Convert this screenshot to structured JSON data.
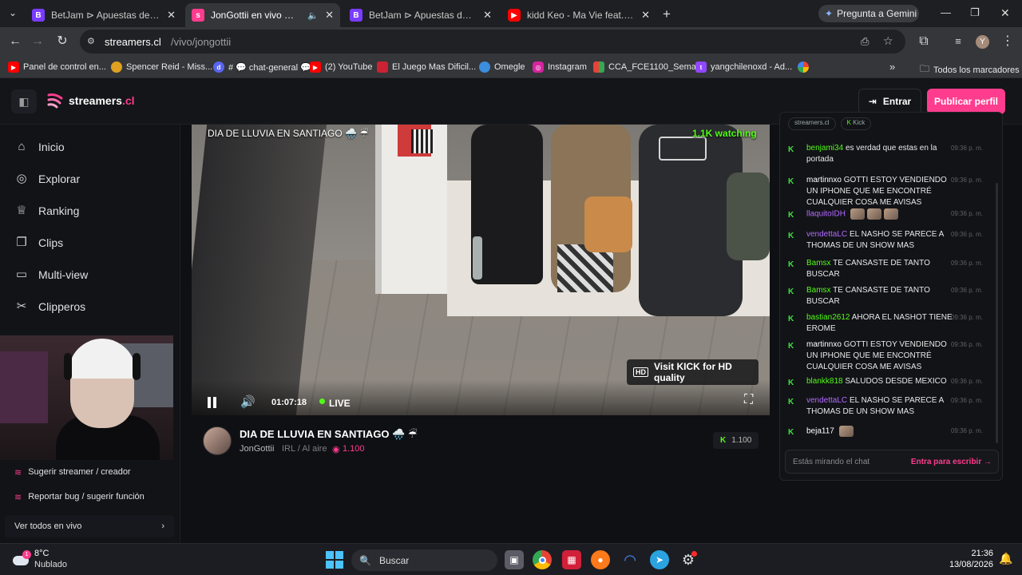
{
  "browser": {
    "tabs": [
      {
        "title": "BetJam ⊳ Apuestas deportivas",
        "favicon": "betjam-icon",
        "color": "#7a3cff"
      },
      {
        "title": "JonGottii en vivo — streamers",
        "favicon": "streamers-icon",
        "color": "#ff3c8e"
      },
      {
        "title": "BetJam ⊳ Apuestas deportivas",
        "favicon": "betjam-icon",
        "color": "#7a3cff"
      },
      {
        "title": "kidd Keo - Ma Vie feat. Yay (Bie",
        "favicon": "youtube-icon",
        "color": "#ff0000"
      }
    ],
    "gemini_label": "Pregunta a Gemini",
    "url_host": "streamers.cl",
    "url_path": "/vivo/jongottii",
    "profile_initial": "Y",
    "bookmarks": [
      {
        "label": "Panel de control en...",
        "icon": "youtube-icon",
        "color": "#ff0000"
      },
      {
        "label": "Spencer Reid - Miss...",
        "icon": "site-icon",
        "color": "#e0a020"
      },
      {
        "label": "# 💬 chat-general 💬",
        "icon": "discord-icon",
        "color": "#5865f2"
      },
      {
        "label": "(2) YouTube",
        "icon": "youtube-icon",
        "color": "#ff0000"
      },
      {
        "label": "El Juego Mas Dificil...",
        "icon": "site-icon",
        "color": "#cc2233"
      },
      {
        "label": "Omegle",
        "icon": "omegle-icon",
        "color": "#3b8dde"
      },
      {
        "label": "Instagram",
        "icon": "instagram-icon",
        "color": "#d6249f"
      },
      {
        "label": "CCA_FCE1100_Sema...",
        "icon": "grid-icon",
        "color": "#e94335"
      },
      {
        "label": "yangchilenoxd - Ad...",
        "icon": "twitch-icon",
        "color": "#9146ff"
      }
    ],
    "all_bookmarks_label": "Todos los marcadores"
  },
  "site": {
    "logo_text": "streamers",
    "logo_suffix": ".cl",
    "login_label": "Entrar",
    "publish_label": "Publicar perfil",
    "accent": "#ff3c8e"
  },
  "sidebar": {
    "items": [
      {
        "label": "Inicio",
        "icon": "home-icon"
      },
      {
        "label": "Explorar",
        "icon": "compass-icon"
      },
      {
        "label": "Ranking",
        "icon": "trophy-icon"
      },
      {
        "label": "Clips",
        "icon": "clips-icon"
      },
      {
        "label": "Multi-view",
        "icon": "multiview-icon"
      },
      {
        "label": "Clipperos",
        "icon": "scissors-icon"
      }
    ],
    "suggest_label": "Sugerir streamer / creador",
    "report_label": "Reportar bug / sugerir función",
    "all_live_label": "Ver todos en vivo"
  },
  "player": {
    "overlay_title": "DIA DE LLUVIA EN SANTIAGO 🌧️ ☔",
    "watching": "1.1K watching",
    "hd_badge": "HD",
    "hd_text": "Visit KICK for HD quality",
    "time": "01:07:18",
    "live_label": "LIVE"
  },
  "stream": {
    "title": "DIA DE LLUVIA EN SANTIAGO 🌧️ ☔",
    "channel": "JonGottii",
    "category": "IRL / Al aire",
    "viewers": "1.100",
    "platform_viewers": "1.100"
  },
  "chat": {
    "tags": [
      "streamers.cl",
      "Kick"
    ],
    "messages": [
      {
        "user": "benjami34",
        "color": "#53fc18",
        "text": "es verdad que estas en la portada",
        "time": "09:36 p. m."
      },
      {
        "user": "martinnxo",
        "color": "#ffffff",
        "text": "GOTTI ESTOY VENDIENDO UN IPHONE QUE ME ENCONTRÉ CUALQUIER COSA ME AVISAS",
        "time": "09:36 p. m."
      },
      {
        "user": "llaquitoIDH",
        "color": "#b36bff",
        "text": "",
        "time": "09:36 p. m.",
        "emotes": 3
      },
      {
        "user": "vendettaLC",
        "color": "#b36bff",
        "text": "EL NASHO SE PARECE A THOMAS DE UN SHOW MAS",
        "time": "09:36 p. m."
      },
      {
        "user": "Bamsx",
        "color": "#53fc18",
        "text": "TE CANSASTE DE TANTO BUSCAR",
        "time": "09:36 p. m."
      },
      {
        "user": "Bamsx",
        "color": "#53fc18",
        "text": "TE CANSASTE DE TANTO BUSCAR",
        "time": "09:36 p. m."
      },
      {
        "user": "bastian2612",
        "color": "#53fc18",
        "text": "AHORA EL NASHOT TIENE EROME",
        "time": "09:36 p. m."
      },
      {
        "user": "martinnxo",
        "color": "#ffffff",
        "text": "GOTTI ESTOY VENDIENDO UN IPHONE QUE ME ENCONTRÉ CUALQUIER COSA ME AVISAS",
        "time": "09:36 p. m."
      },
      {
        "user": "blankk818",
        "color": "#53fc18",
        "text": "SALUDOS DESDE MEXICO",
        "time": "09:36 p. m."
      },
      {
        "user": "vendettaLC",
        "color": "#b36bff",
        "text": "EL NASHO SE PARECE A THOMAS DE UN SHOW MAS",
        "time": "09:36 p. m."
      },
      {
        "user": "beja117",
        "color": "#ffffff",
        "text": "",
        "time": "09:36 p. m.",
        "emotes": 1
      }
    ],
    "input_placeholder": "Estás mirando el chat",
    "login_to_write": "Entra para escribir →"
  },
  "taskbar": {
    "temp": "8°C",
    "weather": "Nublado",
    "weather_badge": "1",
    "search_placeholder": "Buscar",
    "time": "21:36",
    "date": "13/08/2026"
  }
}
